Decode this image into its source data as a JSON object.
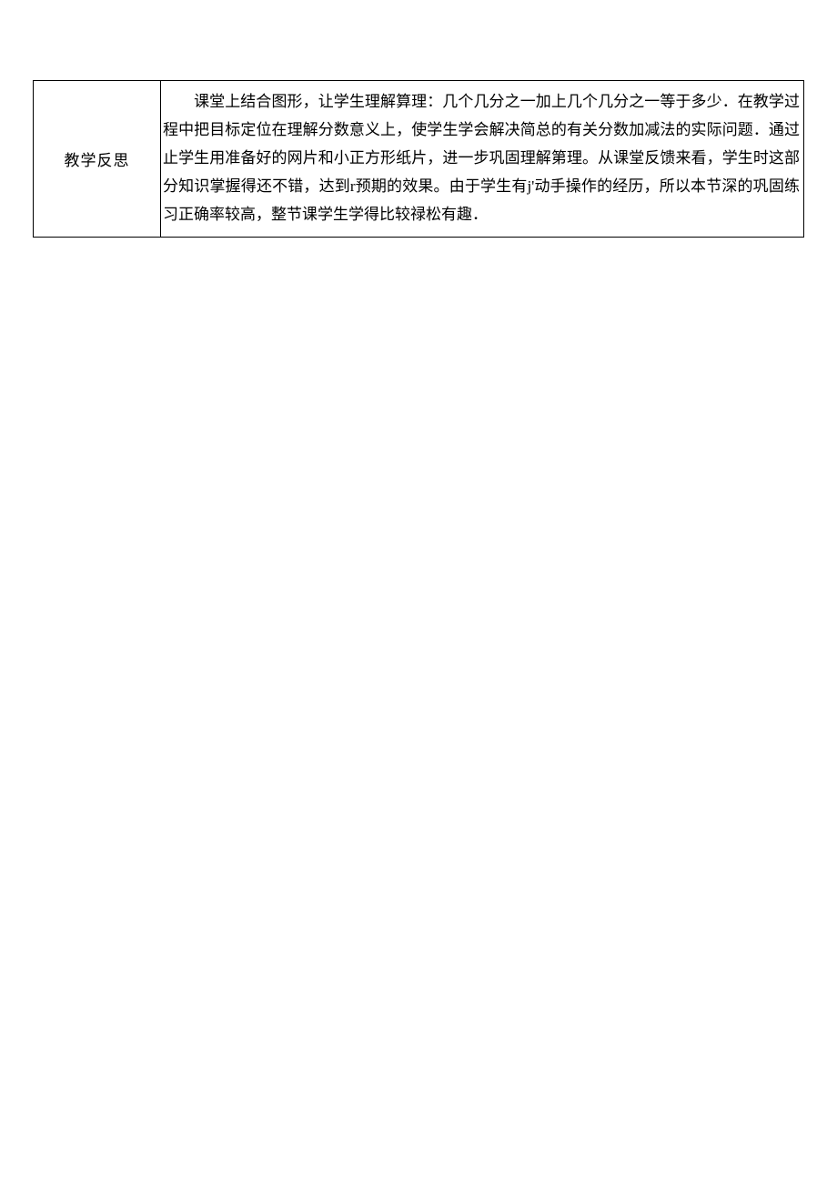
{
  "row": {
    "label": "教学反思",
    "content_part1": "课堂上结合图形，让学生理解算理：几个几分之一加上几个几分之一等于多少．在教学过程中把目标定位在理解分数意义上，使学生学会解决简总的有关分数加减法的实际问题．通过止学生用准备好的网片和小正方形纸片，进一步巩固理解第理。从课堂反馈来看，学生时这部分知识掌握得还不错，达到r预期的效果。由于学生有j'动手操作的经历，所以本节深的巩固练习正确率较高，整节课学生学得比较禄松有趣．"
  }
}
